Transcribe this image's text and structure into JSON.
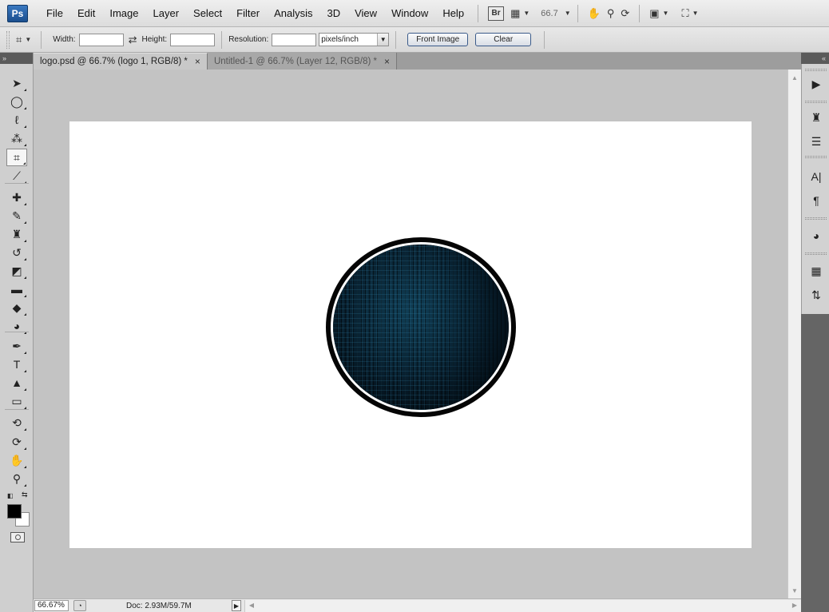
{
  "app": {
    "logo": "Ps"
  },
  "menu": [
    "File",
    "Edit",
    "Image",
    "Layer",
    "Select",
    "Filter",
    "Analysis",
    "3D",
    "View",
    "Window",
    "Help"
  ],
  "appbar": {
    "bridge_label": "Br",
    "zoom_value": "66.7",
    "icons": [
      "launch-bridge-icon",
      "view-extras-icon",
      "hand-icon",
      "zoom-icon",
      "rotate-view-icon",
      "arrange-documents-icon",
      "screen-mode-icon"
    ]
  },
  "options": {
    "width_label": "Width:",
    "width_value": "",
    "height_label": "Height:",
    "height_value": "",
    "resolution_label": "Resolution:",
    "resolution_value": "",
    "resolution_unit": "pixels/inch",
    "front_image_label": "Front Image",
    "clear_label": "Clear"
  },
  "tabs": [
    {
      "label": "logo.psd @ 66.7% (logo 1, RGB/8) *",
      "close": "×",
      "active": true
    },
    {
      "label": "Untitled-1 @ 66.7% (Layer 12, RGB/8) *",
      "close": "×",
      "active": false
    }
  ],
  "toolbox": {
    "collapse_glyph": "»",
    "tools": [
      {
        "name": "move-tool",
        "glyph": "➤"
      },
      {
        "name": "elliptical-marquee-tool",
        "glyph": "◯"
      },
      {
        "name": "lasso-tool",
        "glyph": "ℓ"
      },
      {
        "name": "magic-wand-tool",
        "glyph": "⁂"
      },
      {
        "name": "crop-tool",
        "glyph": "⌗",
        "active": true
      },
      {
        "name": "eyedropper-tool",
        "glyph": "⟋"
      },
      {
        "name": "healing-brush-tool",
        "glyph": "✚"
      },
      {
        "name": "brush-tool",
        "glyph": "✎"
      },
      {
        "name": "clone-stamp-tool",
        "glyph": "♜"
      },
      {
        "name": "history-brush-tool",
        "glyph": "↺"
      },
      {
        "name": "eraser-tool",
        "glyph": "◩"
      },
      {
        "name": "gradient-tool",
        "glyph": "▬"
      },
      {
        "name": "blur-tool",
        "glyph": "◆"
      },
      {
        "name": "dodge-tool",
        "glyph": "◕"
      },
      {
        "name": "pen-tool",
        "glyph": "✒"
      },
      {
        "name": "type-tool",
        "glyph": "T"
      },
      {
        "name": "path-selection-tool",
        "glyph": "▲"
      },
      {
        "name": "rectangle-tool",
        "glyph": "▭"
      },
      {
        "name": "3d-rotate-tool",
        "glyph": "⟲"
      },
      {
        "name": "3d-orbit-tool",
        "glyph": "⟳"
      },
      {
        "name": "hand-tool",
        "glyph": "✋"
      },
      {
        "name": "zoom-tool",
        "glyph": "⚲"
      }
    ]
  },
  "status": {
    "zoom": "66.67%",
    "doc_info": "Doc: 2.93M/59.7M"
  },
  "dock": {
    "collapse_glyph": "«",
    "icons": [
      "animation-icon",
      "clone-source-icon",
      "layer-comps-icon",
      "character-icon",
      "paragraph-icon",
      "styles-icon",
      "swatches-icon",
      "navigator-icon"
    ]
  },
  "colors": {
    "foreground": "#000000",
    "background": "#ffffff",
    "pasteboard": "#c3c3c3",
    "logo_fill": "#0b2a3c"
  }
}
